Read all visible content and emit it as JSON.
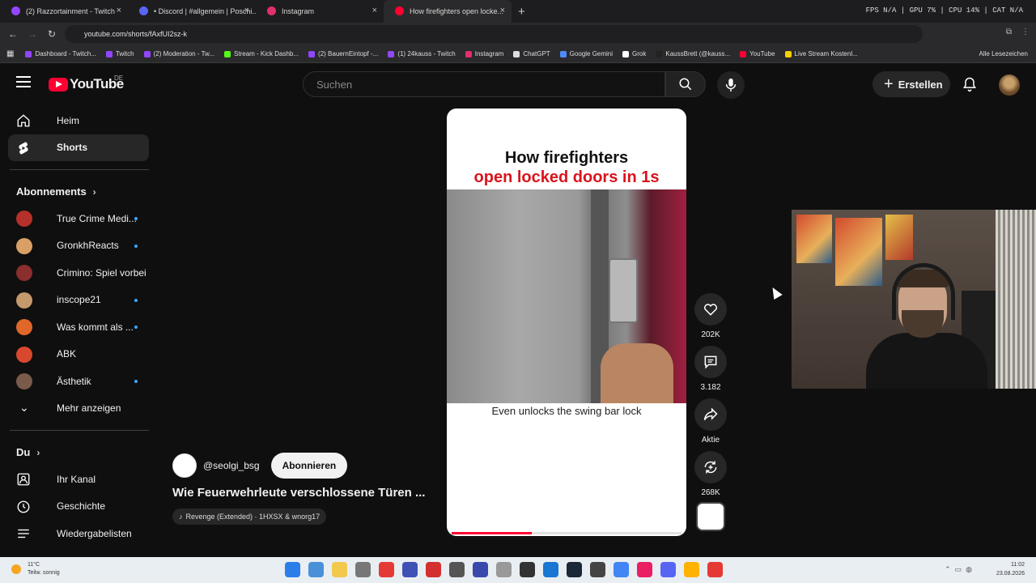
{
  "browser": {
    "tabs": [
      {
        "label": "(2) Razzortainment - Twitch",
        "color": "#9146ff"
      },
      {
        "label": "• Discord | #allgemein | Poschi...",
        "color": "#5865f2"
      },
      {
        "label": "Instagram",
        "color": "#e1306c"
      },
      {
        "label": "How firefighters open locke...",
        "color": "#ff0033",
        "active": true
      }
    ],
    "stats": "FPS N/A | GPU 7% | CPU 14% | CAT N/A",
    "url": "youtube.com/shorts/fAxfUI2sz-k",
    "bookmarks": [
      {
        "label": "Dashboard - Twitch...",
        "color": "#9146ff"
      },
      {
        "label": "Twitch",
        "color": "#9146ff"
      },
      {
        "label": "(2) Moderation - Tw...",
        "color": "#9146ff"
      },
      {
        "label": "Stream - Kick Dashb...",
        "color": "#53fc18"
      },
      {
        "label": "(2) BauernEintopf -...",
        "color": "#9146ff"
      },
      {
        "label": "(1) 24kauss - Twitch",
        "color": "#9146ff"
      },
      {
        "label": "Instagram",
        "color": "#e1306c"
      },
      {
        "label": "ChatGPT",
        "color": "#dddddd"
      },
      {
        "label": "Google Gemini",
        "color": "#4f8cff"
      },
      {
        "label": "Grok",
        "color": "#ffffff"
      },
      {
        "label": "KaussBrett (@kauss...",
        "color": "#222222"
      },
      {
        "label": "YouTube",
        "color": "#ff0033"
      },
      {
        "label": "Live Stream Kostenl...",
        "color": "#f5d000"
      }
    ],
    "bookmarks_all": "Alle Lesezeichen"
  },
  "header": {
    "logo_text": "YouTube",
    "country": "DE",
    "search_placeholder": "Suchen",
    "create_label": "Erstellen"
  },
  "sidebar": {
    "main": [
      {
        "label": "Heim",
        "active": false
      },
      {
        "label": "Shorts",
        "active": true
      }
    ],
    "subscriptions_title": "Abonnements",
    "subscriptions": [
      {
        "label": "True Crime Medi...",
        "color": "#b5302a",
        "new": true
      },
      {
        "label": "GronkhReacts",
        "color": "#d9a066",
        "new": true
      },
      {
        "label": "Crimino: Spiel vorbei",
        "color": "#8a2e2e",
        "new": false
      },
      {
        "label": "inscope21",
        "color": "#c49a6c",
        "new": true
      },
      {
        "label": "Was kommt als ...",
        "color": "#e0672a",
        "new": true
      },
      {
        "label": "ABK",
        "color": "#d8482e",
        "new": false
      },
      {
        "label": "Ästhetik",
        "color": "#7a5a4a",
        "new": true
      }
    ],
    "more_label": "Mehr anzeigen",
    "you_title": "Du",
    "you_items": [
      {
        "label": "Ihr Kanal"
      },
      {
        "label": "Geschichte"
      },
      {
        "label": "Wiedergabelisten"
      }
    ]
  },
  "video": {
    "title_line1": "How firefighters",
    "title_line2": "open locked doors in 1s",
    "caption": "Even unlocks the swing bar lock",
    "progress": 0.35,
    "channel": "@seolgi_bsg",
    "subscribe_label": "Abonnieren",
    "short_title": "Wie Feuerwehrleute verschlossene Türen ...",
    "music": "Revenge (Extended) · 1HXSX & wnorg17"
  },
  "actions": {
    "likes": "202K",
    "comments": "3.182",
    "share_label": "Aktie",
    "remix": "268K"
  },
  "taskbar": {
    "temp": "11°C",
    "weather": "Teilw. sonnig",
    "time": "11:02",
    "date": "23.08.2026"
  }
}
